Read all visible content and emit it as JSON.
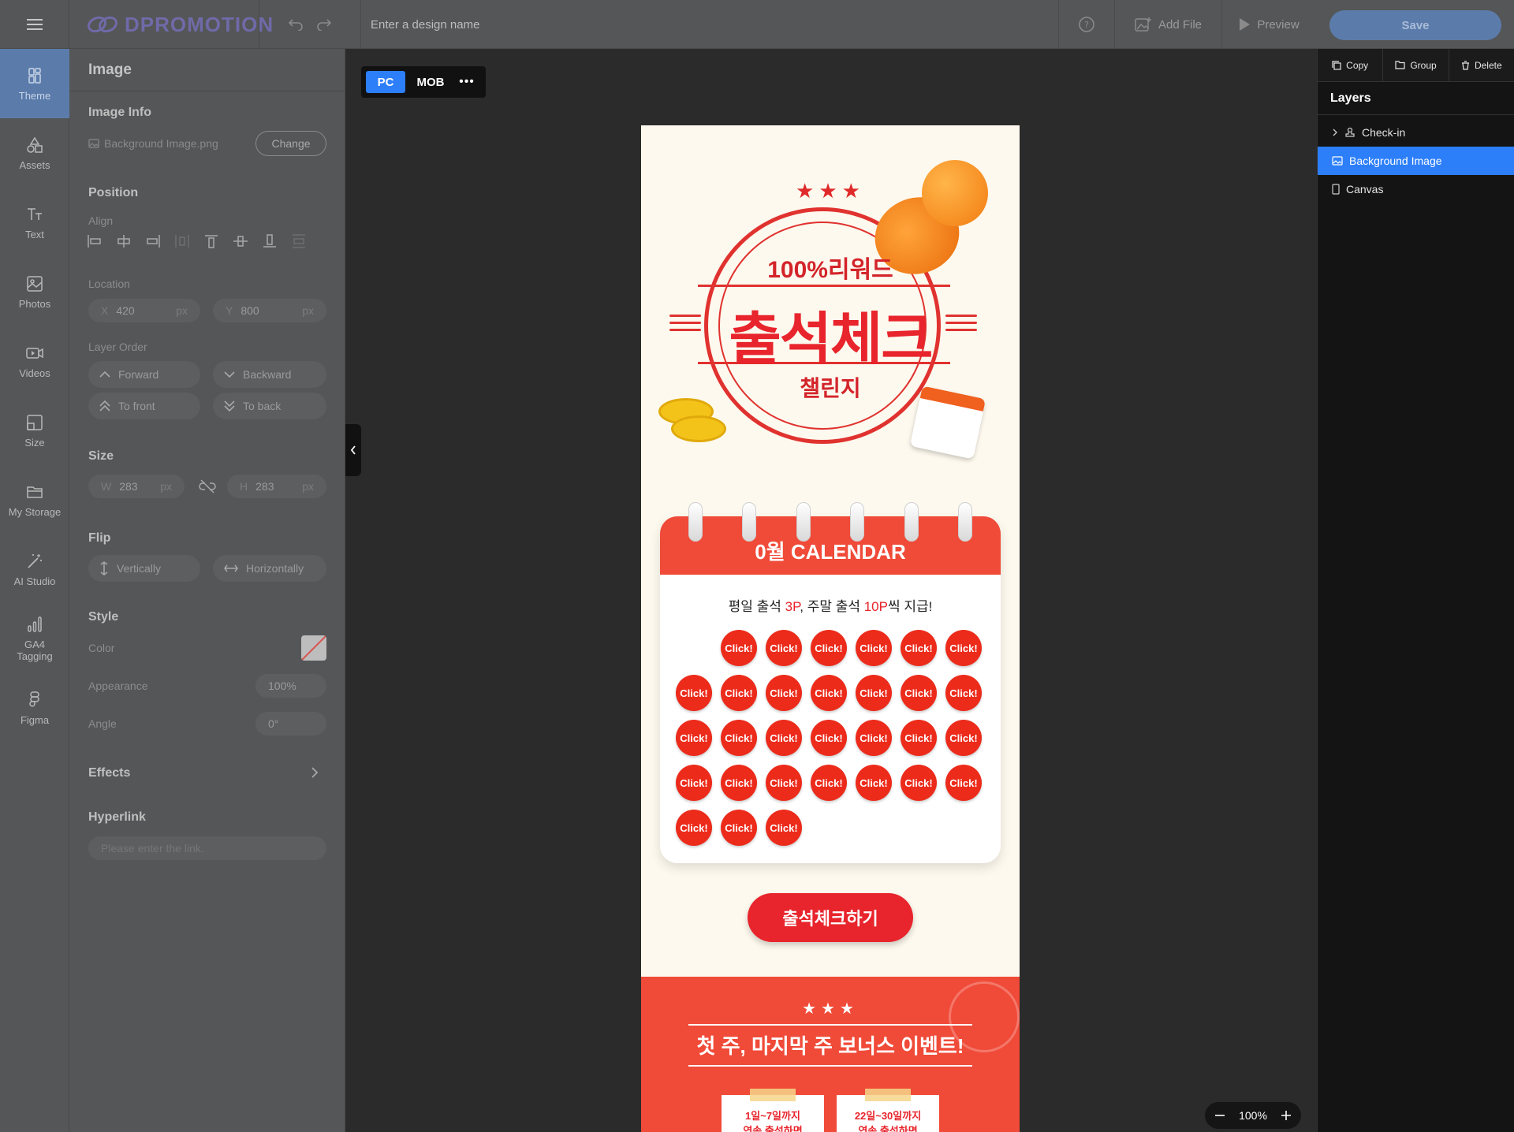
{
  "app": {
    "brand": "DPROMOTION",
    "design_name_placeholder": "Enter a design name",
    "add_file": "Add File",
    "preview": "Preview",
    "save": "Save"
  },
  "rail": [
    {
      "label": "Theme",
      "icon": "theme-icon",
      "active": true
    },
    {
      "label": "Assets",
      "icon": "assets-icon"
    },
    {
      "label": "Text",
      "icon": "text-icon"
    },
    {
      "label": "Photos",
      "icon": "photos-icon"
    },
    {
      "label": "Videos",
      "icon": "videos-icon"
    },
    {
      "label": "Size",
      "icon": "size-icon"
    },
    {
      "label": "My Storage",
      "icon": "folder-icon"
    },
    {
      "label": "AI Studio",
      "icon": "magic-wand-icon"
    },
    {
      "label": "GA4 Tagging",
      "icon": "analytics-icon"
    },
    {
      "label": "Figma",
      "icon": "figma-icon"
    }
  ],
  "props": {
    "title": "Image",
    "image_info": "Image Info",
    "file_name": "Background Image.png",
    "change": "Change",
    "position": "Position",
    "align": "Align",
    "location": "Location",
    "x_label": "X",
    "x": "420",
    "y_label": "Y",
    "y": "800",
    "unit": "px",
    "layer_order": "Layer Order",
    "forward": "Forward",
    "backward": "Backward",
    "to_front": "To front",
    "to_back": "To back",
    "size": "Size",
    "w_label": "W",
    "w": "283",
    "h_label": "H",
    "h": "283",
    "flip": "Flip",
    "vertically": "Vertically",
    "horizontally": "Horizontally",
    "style": "Style",
    "color": "Color",
    "appearance": "Appearance",
    "appearance_value": "100%",
    "angle": "Angle",
    "angle_value": "0°",
    "effects": "Effects",
    "hyperlink": "Hyperlink",
    "link_placeholder": "Please enter the link."
  },
  "canvas": {
    "pc": "PC",
    "mob": "MOB",
    "more": "•••",
    "zoom": "100%",
    "design": {
      "reward": "100%리워드",
      "title": "출석체크",
      "subtitle": "챌린지",
      "calendar_title": "0월 CALENDAR",
      "desc_pre": "평일 출석 ",
      "desc_hl1": "3P",
      "desc_mid": ", 주말 출석 ",
      "desc_hl2": "10P",
      "desc_post": "씩 지급!",
      "day_label": "Click!",
      "button": "출석체크하기",
      "bonus_title": "첫 주, 마지막 주 보너스 이벤트!",
      "card1": "1일~7일까지",
      "card2": "22일~30일까지",
      "card_sub": "연속 출석하면"
    }
  },
  "layers": {
    "copy": "Copy",
    "group": "Group",
    "delete": "Delete",
    "title": "Layers",
    "items": [
      {
        "label": "Check-in",
        "selected": false
      },
      {
        "label": "Background Image",
        "selected": true
      },
      {
        "label": "Canvas",
        "selected": false
      }
    ]
  }
}
